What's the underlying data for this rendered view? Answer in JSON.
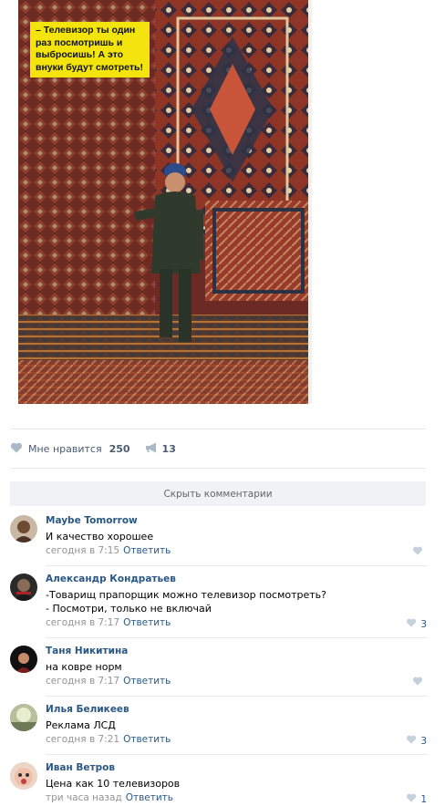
{
  "post": {
    "caption": "– Телевизор ты один раз посмотришь и выбросишь! А это внуки будут смотреть!",
    "like_label": "Мне нравится",
    "like_count": "250",
    "share_count": "13",
    "hide_comments_label": "Скрыть комментарии"
  },
  "comments": [
    {
      "author": "Maybe Tomorrow",
      "text": "И качество хорошее",
      "time": "сегодня в 7:15",
      "reply": "Ответить",
      "likes": ""
    },
    {
      "author": "Александр Кондратьев",
      "text": "-Товарищ прапорщик можно телевизор посмотреть?\n- Посмотри, только не включай",
      "time": "сегодня в 7:17",
      "reply": "Ответить",
      "likes": "3"
    },
    {
      "author": "Таня Никитина",
      "text": "на ковре норм",
      "time": "сегодня в 7:17",
      "reply": "Ответить",
      "likes": ""
    },
    {
      "author": "Илья Беликеев",
      "text": "Реклама ЛСД",
      "time": "сегодня в 7:21",
      "reply": "Ответить",
      "likes": "3"
    },
    {
      "author": "Иван Ветров",
      "text": "Цена как 10 телевизоров",
      "time": "три часа назад",
      "reply": "Ответить",
      "likes": "1"
    }
  ],
  "colors": {
    "link": "#2a5885",
    "meta": "#939393",
    "caption_bg": "#f2e40c",
    "icon": "#aab8c8"
  },
  "icons": {
    "like": "heart-icon",
    "share": "megaphone-icon"
  }
}
